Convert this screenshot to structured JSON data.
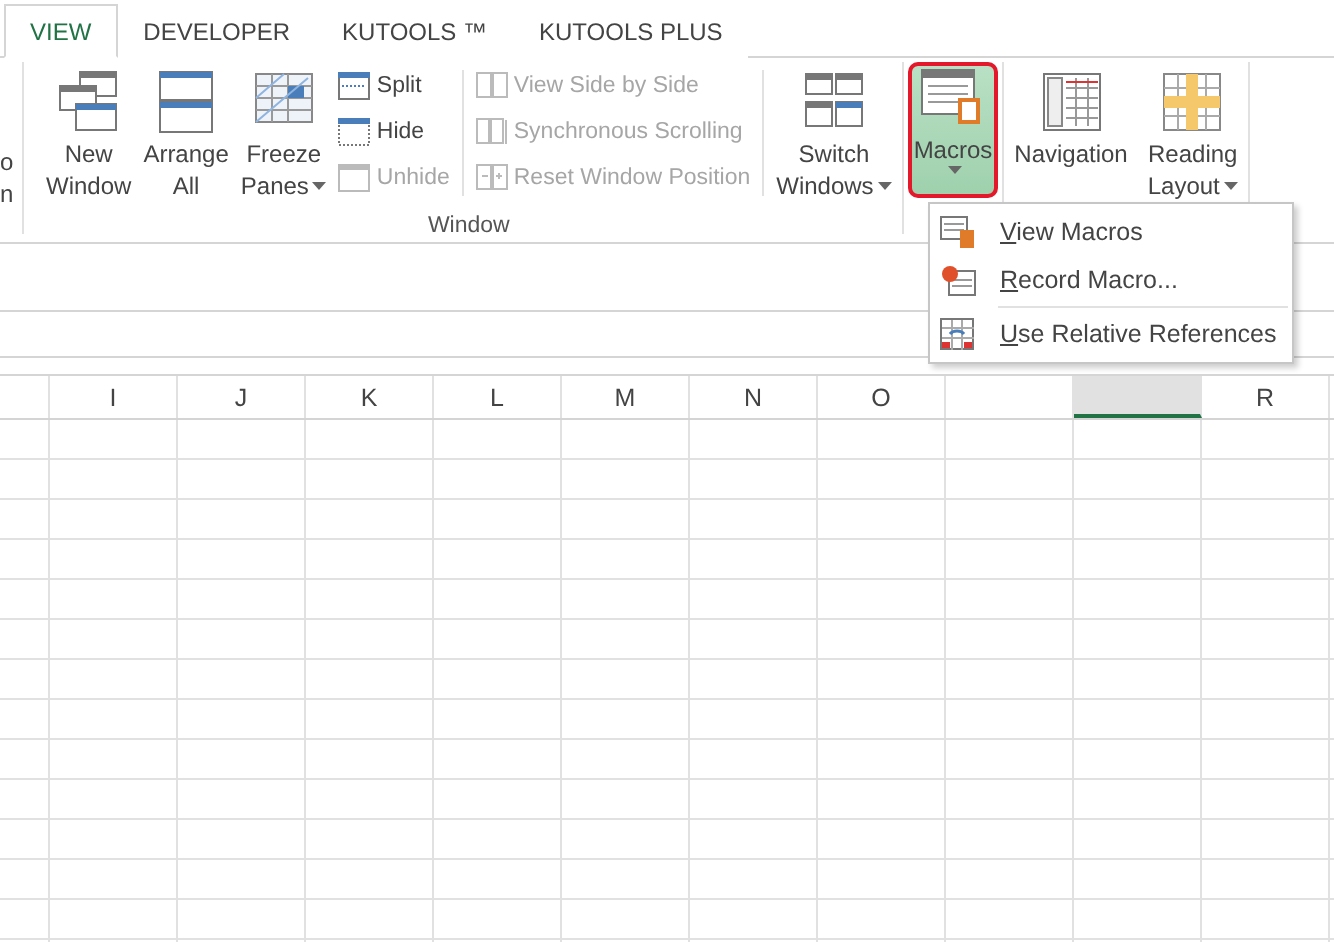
{
  "tabs": [
    {
      "label": "VIEW",
      "selected": true
    },
    {
      "label": "DEVELOPER",
      "selected": false
    },
    {
      "label": "KUTOOLS ™",
      "selected": false
    },
    {
      "label": "KUTOOLS PLUS",
      "selected": false
    }
  ],
  "ribbon": {
    "clipped_button": {
      "lines": [
        "o",
        "n"
      ]
    },
    "window_group": {
      "label": "Window",
      "new_window": {
        "lines": [
          "New",
          "Window"
        ],
        "dropdown": false
      },
      "arrange_all": {
        "lines": [
          "Arrange",
          "All"
        ],
        "dropdown": false
      },
      "freeze_panes": {
        "lines": [
          "Freeze",
          "Panes"
        ],
        "dropdown": true
      },
      "small_buttons": [
        {
          "label": "Split",
          "disabled": false
        },
        {
          "label": "Hide",
          "disabled": false
        },
        {
          "label": "Unhide",
          "disabled": true
        }
      ],
      "compare_buttons": [
        {
          "label": "View Side by Side",
          "disabled": true
        },
        {
          "label": "Synchronous Scrolling",
          "disabled": true
        },
        {
          "label": "Reset Window Position",
          "disabled": true
        }
      ],
      "switch_windows": {
        "lines": [
          "Switch",
          "Windows"
        ],
        "dropdown": true
      }
    },
    "macros": {
      "lines": [
        "Macros"
      ],
      "dropdown": true,
      "selected": true
    },
    "navigation": {
      "lines": [
        "Navigation"
      ],
      "dropdown": false
    },
    "reading_layout": {
      "lines": [
        "Reading",
        "Layout"
      ],
      "dropdown": true
    }
  },
  "macros_menu": [
    {
      "label": "View Macros",
      "separator_before": false
    },
    {
      "label": "Record Macro...",
      "separator_before": false
    },
    {
      "label": "Use Relative References",
      "separator_before": true
    }
  ],
  "columns": [
    {
      "label": "I",
      "selected": false
    },
    {
      "label": "J",
      "selected": false
    },
    {
      "label": "K",
      "selected": false
    },
    {
      "label": "L",
      "selected": false
    },
    {
      "label": "M",
      "selected": false
    },
    {
      "label": "N",
      "selected": false
    },
    {
      "label": "O",
      "selected": false
    },
    {
      "selected": false
    },
    {
      "selected": true
    },
    {
      "label": "R",
      "selected": false
    }
  ]
}
